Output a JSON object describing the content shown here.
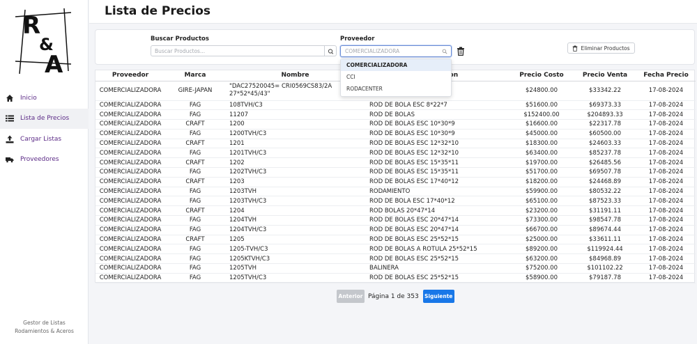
{
  "sidebar": {
    "items": [
      {
        "label": "Inicio",
        "icon": "home-icon"
      },
      {
        "label": "Lista de Precios",
        "icon": "list-icon"
      },
      {
        "label": "Cargar Listas",
        "icon": "upload-icon"
      },
      {
        "label": "Proveedores",
        "icon": "truck-icon"
      }
    ],
    "footer_line1": "Gestor de Listas",
    "footer_line2": "Rodamientos & Aceros"
  },
  "header": {
    "title": "Lista de Precios"
  },
  "filters": {
    "search_label": "Buscar Productos",
    "search_placeholder": "Buscar Productos...",
    "provider_label": "Proveedor",
    "provider_value": "COMERCIALIZADORA",
    "delete_button": "Eliminar Productos"
  },
  "dropdown": {
    "options": [
      "COMERCIALIZADORA",
      "CCI",
      "RODACENTER"
    ]
  },
  "table": {
    "headers": [
      "Proveedor",
      "Marca",
      "Nombre",
      "Descripcion",
      "Precio Costo",
      "Precio Venta",
      "Fecha Precio"
    ],
    "rows": [
      [
        "COMERCIALIZADORA",
        "GIRE-JAPAN",
        "\"DAC27520045= CRI0569CS83/2A 27*52*45/43\"",
        "",
        "$24800.00",
        "$33342.22",
        "17-08-2024"
      ],
      [
        "COMERCIALIZADORA",
        "FAG",
        "108TVH/C3",
        "ROD DE BOLA ESC 8*22*7",
        "$51600.00",
        "$69373.33",
        "17-08-2024"
      ],
      [
        "COMERCIALIZADORA",
        "FAG",
        "11207",
        "ROD DE BOLAS",
        "$152400.00",
        "$204893.33",
        "17-08-2024"
      ],
      [
        "COMERCIALIZADORA",
        "CRAFT",
        "1200",
        "ROD DE BOLAS ESC 10*30*9",
        "$16600.00",
        "$22317.78",
        "17-08-2024"
      ],
      [
        "COMERCIALIZADORA",
        "FAG",
        "1200TVH/C3",
        "ROD DE BOLAS ESC 10*30*9",
        "$45000.00",
        "$60500.00",
        "17-08-2024"
      ],
      [
        "COMERCIALIZADORA",
        "CRAFT",
        "1201",
        "ROD DE BOLAS ESC 12*32*10",
        "$18300.00",
        "$24603.33",
        "17-08-2024"
      ],
      [
        "COMERCIALIZADORA",
        "FAG",
        "1201TVH/C3",
        "ROD DE BOLAS ESC 12*32*10",
        "$63400.00",
        "$85237.78",
        "17-08-2024"
      ],
      [
        "COMERCIALIZADORA",
        "CRAFT",
        "1202",
        "ROD DE BOLAS ESC 15*35*11",
        "$19700.00",
        "$26485.56",
        "17-08-2024"
      ],
      [
        "COMERCIALIZADORA",
        "FAG",
        "1202TVH/C3",
        "ROD DE BOLAS ESC 15*35*11",
        "$51700.00",
        "$69507.78",
        "17-08-2024"
      ],
      [
        "COMERCIALIZADORA",
        "CRAFT",
        "1203",
        "ROD DE BOLAS ESC 17*40*12",
        "$18200.00",
        "$24468.89",
        "17-08-2024"
      ],
      [
        "COMERCIALIZADORA",
        "FAG",
        "1203TVH",
        "RODAMIENTO",
        "$59900.00",
        "$80532.22",
        "17-08-2024"
      ],
      [
        "COMERCIALIZADORA",
        "FAG",
        "1203TVH/C3",
        "ROD DE BOLA ESC 17*40*12",
        "$65100.00",
        "$87523.33",
        "17-08-2024"
      ],
      [
        "COMERCIALIZADORA",
        "CRAFT",
        "1204",
        "ROD BOLAS 20*47*14",
        "$23200.00",
        "$31191.11",
        "17-08-2024"
      ],
      [
        "COMERCIALIZADORA",
        "FAG",
        "1204TVH",
        "ROD DE BOLAS ESC 20*47*14",
        "$73300.00",
        "$98547.78",
        "17-08-2024"
      ],
      [
        "COMERCIALIZADORA",
        "FAG",
        "1204TVH/C3",
        "ROD DE BOLAS ESC 20*47*14",
        "$66700.00",
        "$89674.44",
        "17-08-2024"
      ],
      [
        "COMERCIALIZADORA",
        "CRAFT",
        "1205",
        "ROD DE BOLAS ESC 25*52*15",
        "$25000.00",
        "$33611.11",
        "17-08-2024"
      ],
      [
        "COMERCIALIZADORA",
        "FAG",
        "1205-TVH/C3",
        "ROD DE BOLAS A ROTULA 25*52*15",
        "$89200.00",
        "$119924.44",
        "17-08-2024"
      ],
      [
        "COMERCIALIZADORA",
        "FAG",
        "1205KTVH/C3",
        "ROD DE BOLAS ESC 25*52*15",
        "$63200.00",
        "$84968.89",
        "17-08-2024"
      ],
      [
        "COMERCIALIZADORA",
        "FAG",
        "1205TVH",
        "BALINERA",
        "$75200.00",
        "$101102.22",
        "17-08-2024"
      ],
      [
        "COMERCIALIZADORA",
        "FAG",
        "1205TVH/C3",
        "ROD DE BOLAS ESC 25*52*15",
        "$58900.00",
        "$79187.78",
        "17-08-2024"
      ]
    ]
  },
  "pagination": {
    "prev_label": "Anterior",
    "info": "Página 1 de 353",
    "next_label": "Siguiente"
  },
  "colors": {
    "accent": "#5b2a86",
    "primary_button": "#1877e8",
    "disabled_button": "#c4c7cc"
  }
}
